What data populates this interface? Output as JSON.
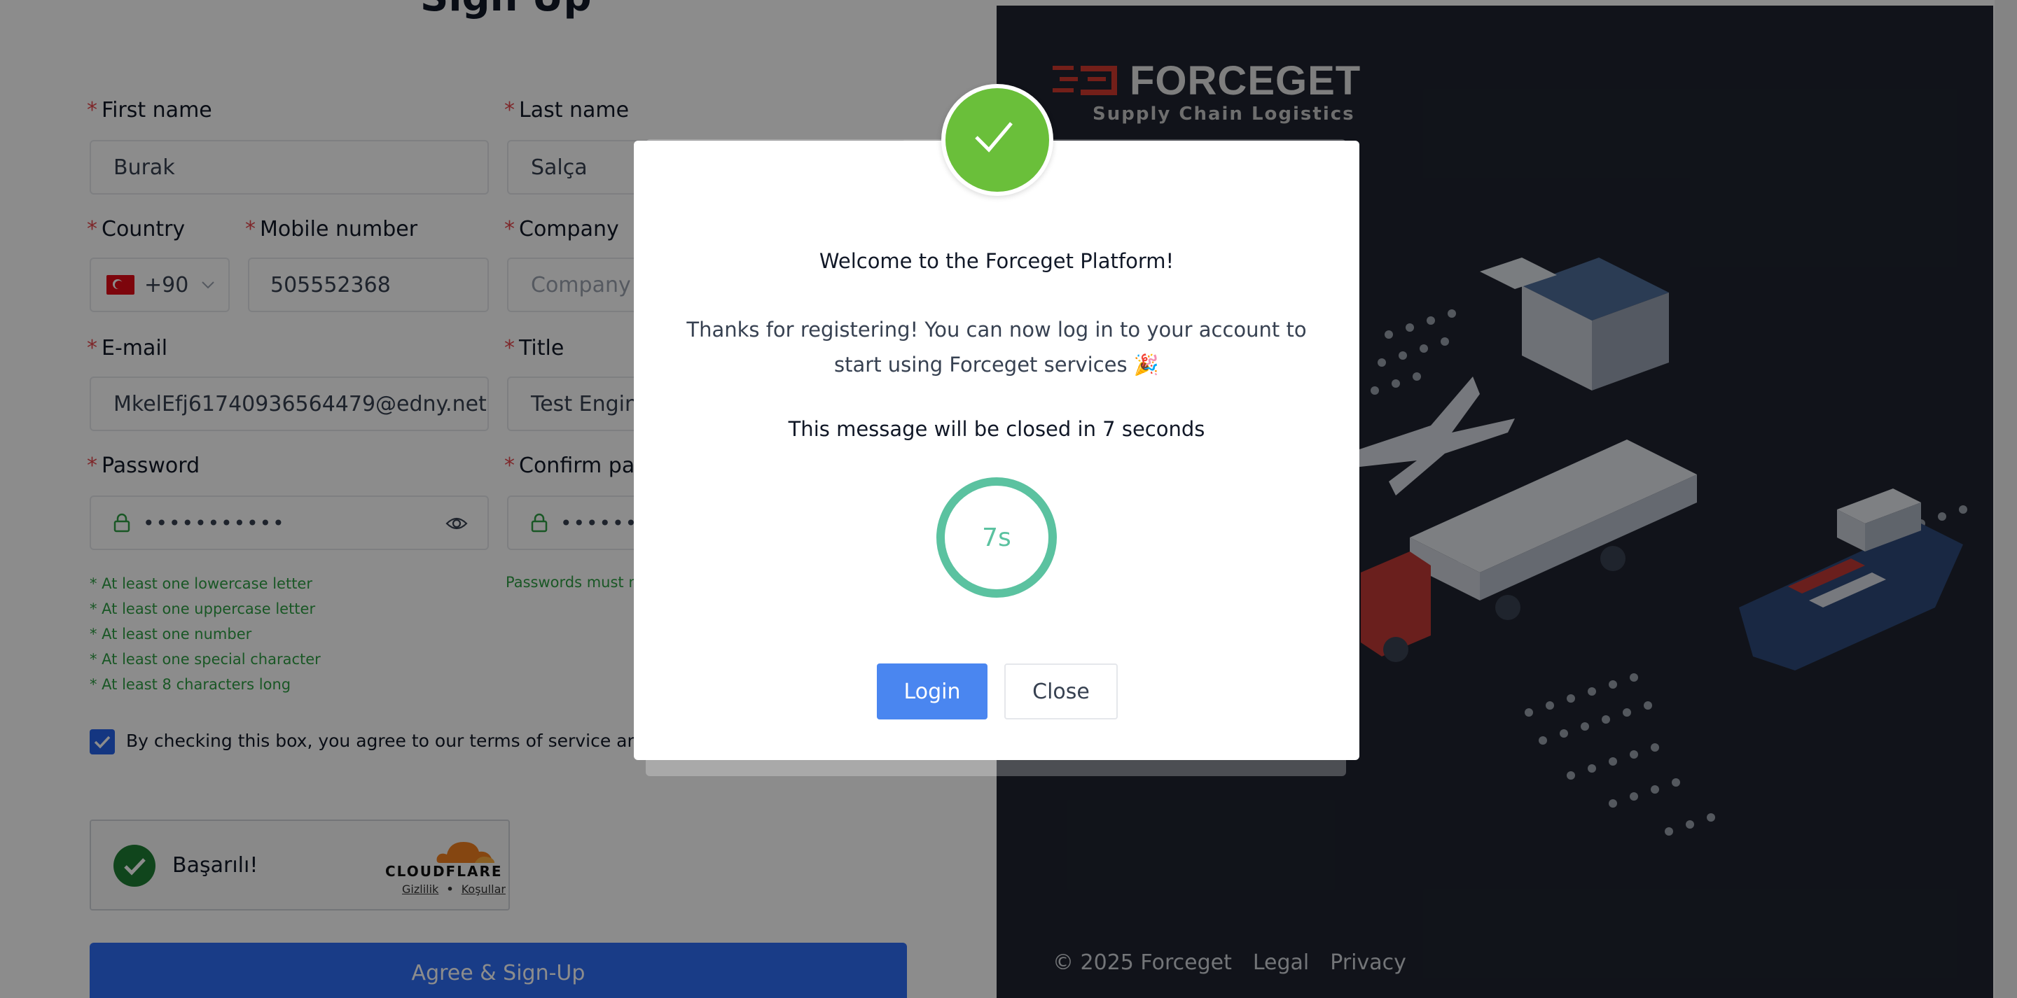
{
  "form": {
    "title": "Sign Up",
    "first_name": {
      "label": "First name",
      "value": "Burak"
    },
    "last_name": {
      "label": "Last name",
      "value": "Salça"
    },
    "country": {
      "label": "Country",
      "value": "+90",
      "flag": "turkey-flag-icon"
    },
    "mobile": {
      "label": "Mobile number",
      "value": "505552368"
    },
    "company": {
      "label": "Company",
      "placeholder": "Company"
    },
    "email": {
      "label": "E-mail",
      "value": "MkelEfj61740936564479@edny.net"
    },
    "title_field": {
      "label": "Title",
      "value": "Test Engineer"
    },
    "password": {
      "label": "Password",
      "value": "•••••••••••"
    },
    "confirm_password": {
      "label": "Confirm password",
      "value": "•••••••••••"
    },
    "password_rules": [
      "* At least one lowercase letter",
      "* At least one uppercase letter",
      "* At least one number",
      "* At least one special character",
      "* At least 8 characters long"
    ],
    "password_match_text": "Passwords must match",
    "terms_text": "By checking this box, you agree to our terms of service and privacy policy",
    "required_mark": "*",
    "submit_label": "Agree & Sign-Up"
  },
  "captcha": {
    "status_text": "Başarılı!",
    "brand": "CLOUDFLARE",
    "link_privacy": "Gizlilik",
    "link_separator": "•",
    "link_terms": "Koşullar"
  },
  "brand_panel": {
    "logo_text": "FORCEGET",
    "logo_subtitle": "Supply  Chain  Logistics",
    "footer_copyright": "© 2025 Forceget",
    "footer_legal": "Legal",
    "footer_privacy": "Privacy"
  },
  "modal": {
    "title": "Welcome to the Forceget Platform!",
    "body": "Thanks for registering! You can now log in to your account to start using Forceget services 🎉",
    "countdown_message": "This message will be closed in 7 seconds",
    "countdown_value": "7s",
    "login_label": "Login",
    "close_label": "Close"
  },
  "colors": {
    "success": "#6abf3a",
    "countdown": "#5bc2a0",
    "primary": "#4a86f0",
    "panel": "#1f2430",
    "logo_red": "#d23a2f"
  }
}
